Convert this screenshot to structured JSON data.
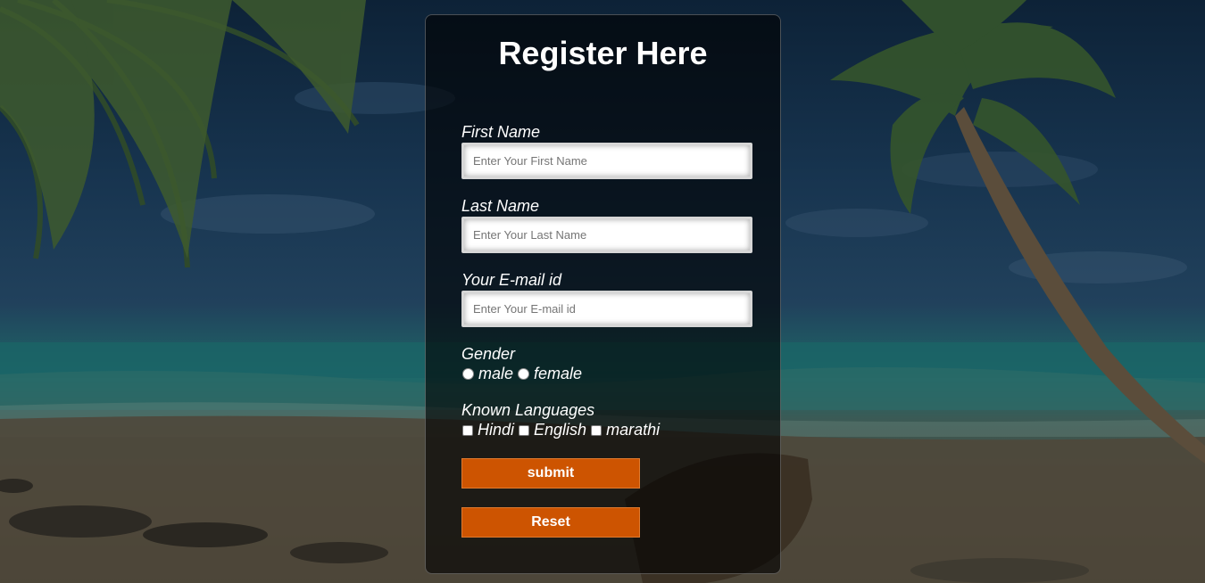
{
  "form": {
    "title": "Register Here",
    "first_name": {
      "label": "First Name",
      "placeholder": "Enter Your First Name",
      "value": ""
    },
    "last_name": {
      "label": "Last Name",
      "placeholder": "Enter Your Last Name",
      "value": ""
    },
    "email": {
      "label": "Your E-mail id",
      "placeholder": "Enter Your E-mail id",
      "value": ""
    },
    "gender": {
      "label": "Gender",
      "options": [
        "male",
        "female"
      ]
    },
    "languages": {
      "label": "Known Languages",
      "options": [
        "Hindi",
        "English",
        "marathi"
      ]
    },
    "submit_label": "submit",
    "reset_label": "Reset"
  },
  "colors": {
    "button": "#cd5401",
    "card_background": "rgba(0,0,0,0.62)",
    "text": "#ffffff"
  },
  "background": {
    "scene": "tropical-beach-night"
  }
}
